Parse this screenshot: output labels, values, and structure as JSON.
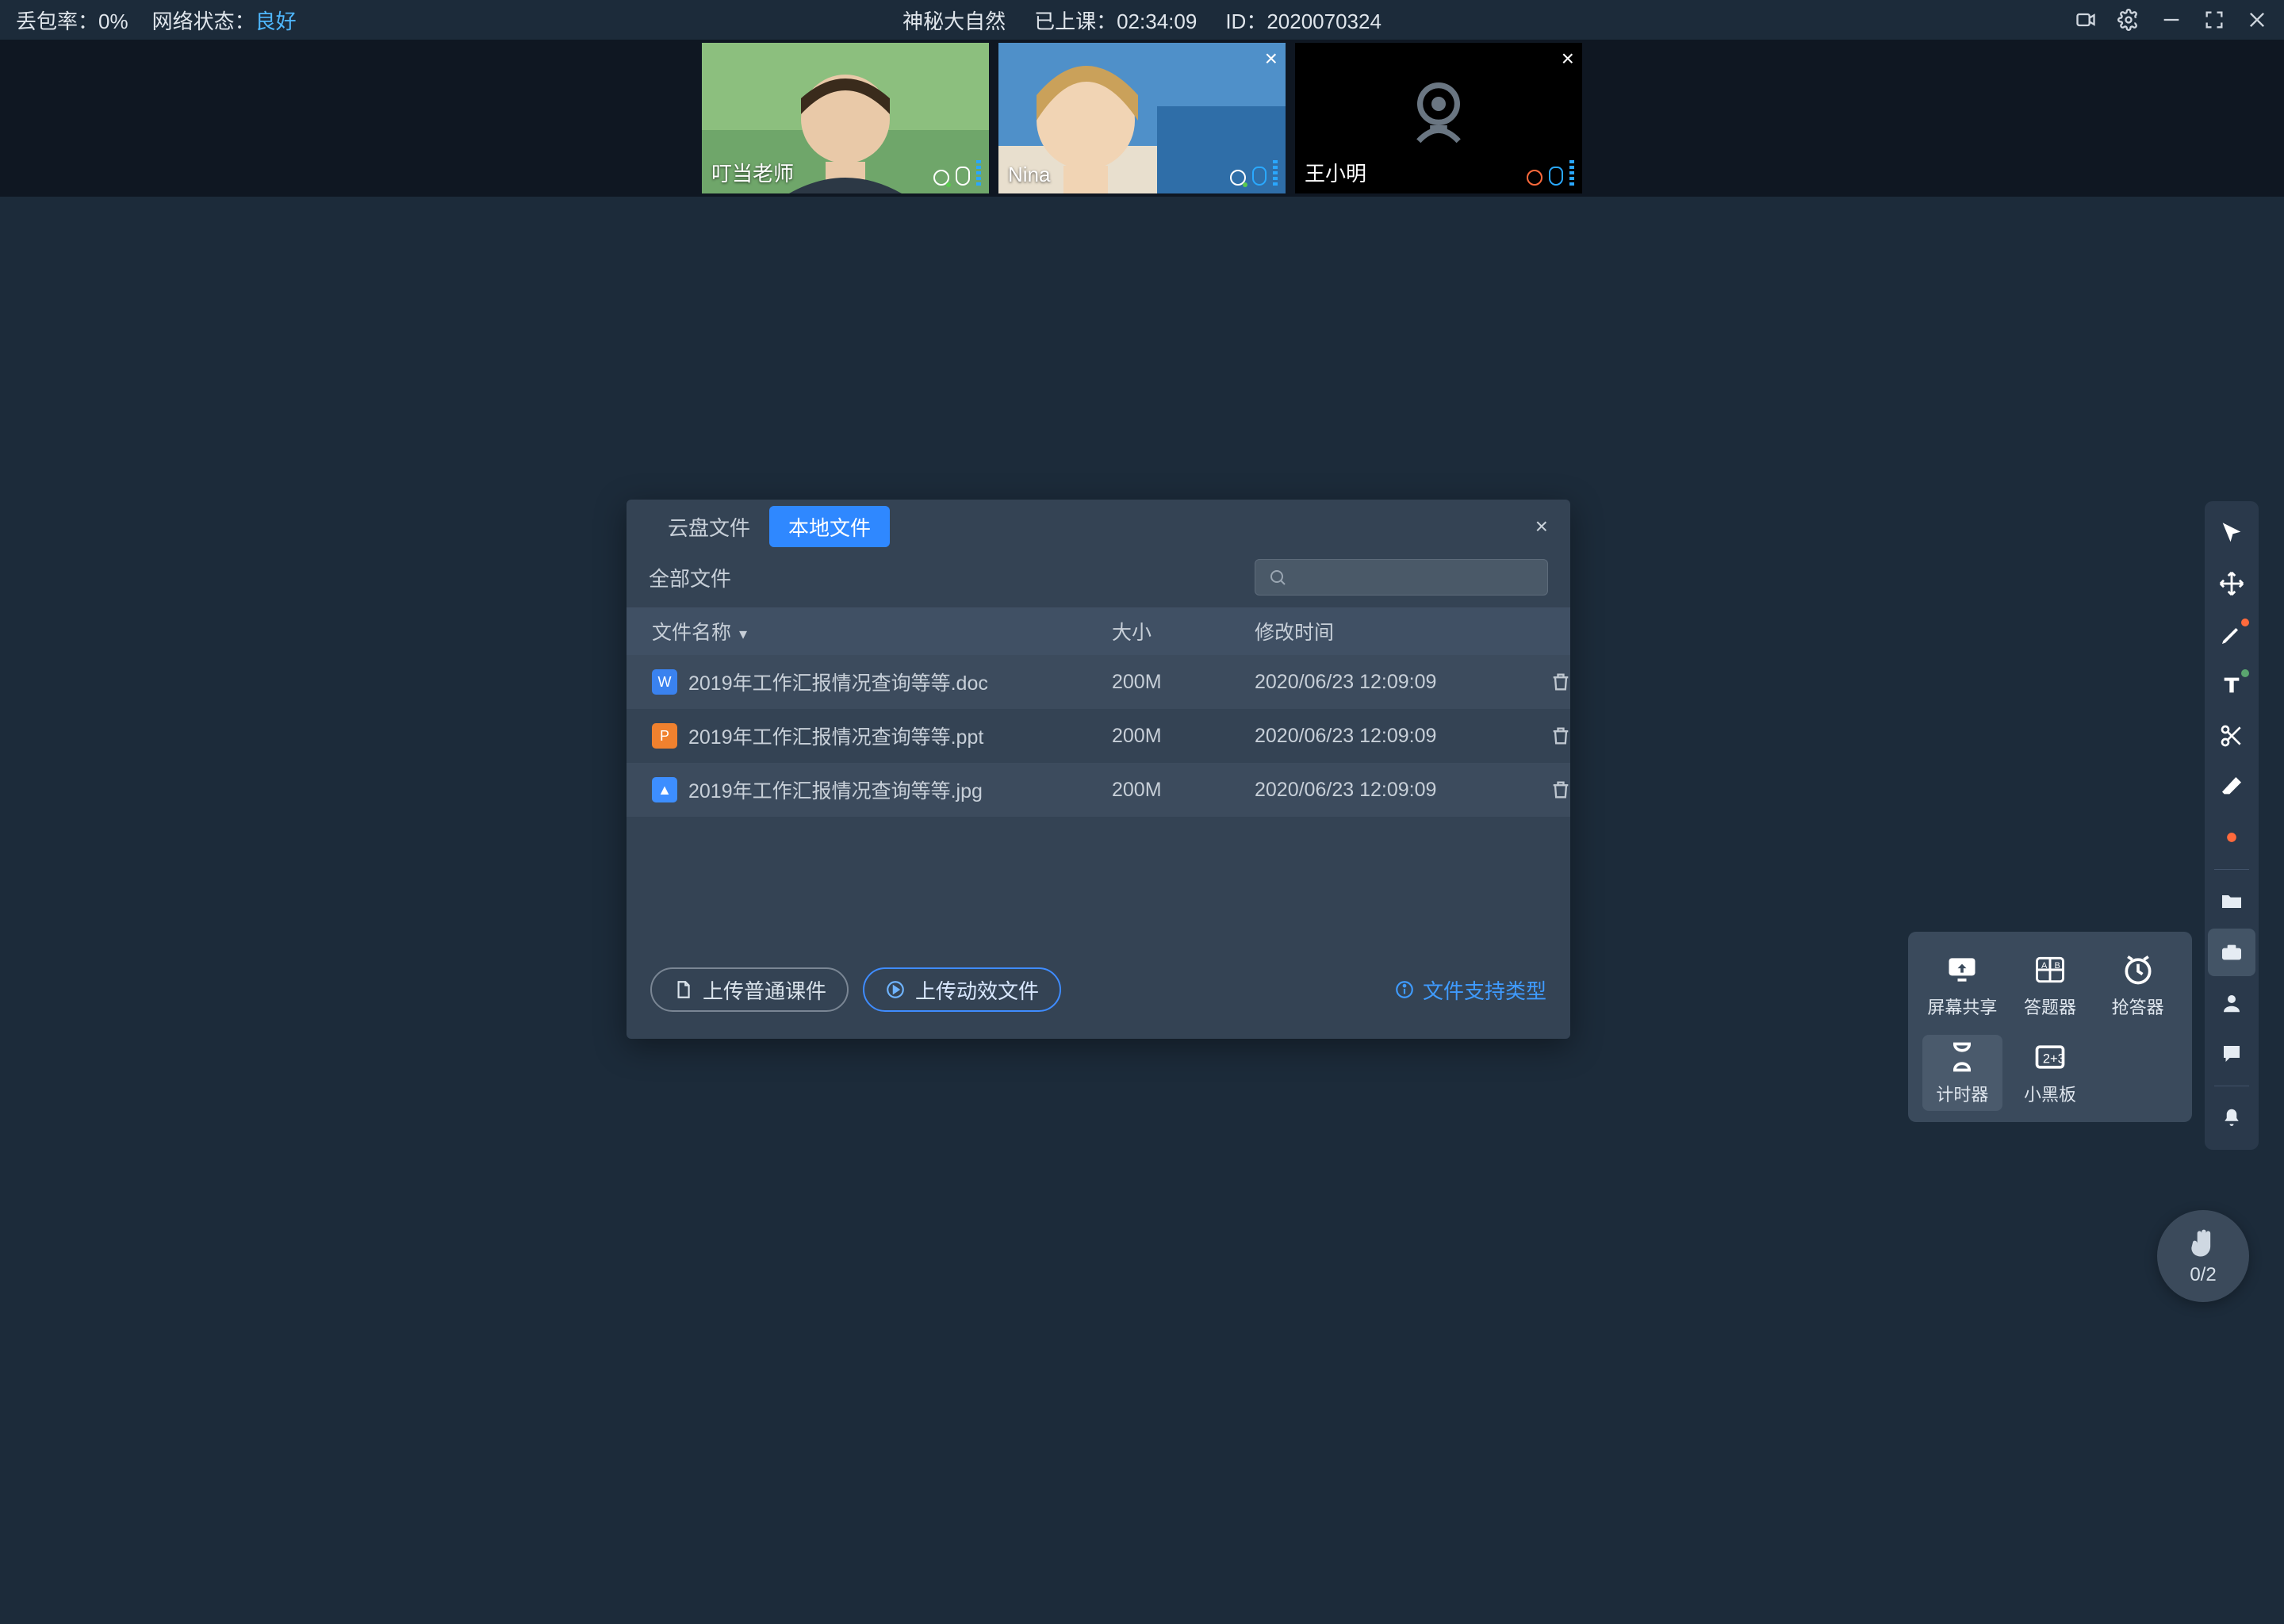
{
  "topbar": {
    "packet_loss_label": "丢包率：",
    "packet_loss_value": "0%",
    "net_status_label": "网络状态：",
    "net_status_value": "良好",
    "title": "神秘大自然",
    "duration_label": "已上课：",
    "duration_value": "02:34:09",
    "id_label": "ID：",
    "id_value": "2020070324"
  },
  "videos": [
    {
      "name": "叮当老师",
      "camera": "on",
      "mic": "on",
      "closable": false
    },
    {
      "name": "Nina",
      "camera": "on",
      "mic": "on",
      "closable": true
    },
    {
      "name": "王小明",
      "camera": "off",
      "mic": "on",
      "closable": true,
      "cam_muted": true
    }
  ],
  "modal": {
    "tabs": {
      "cloud": "云盘文件",
      "local": "本地文件"
    },
    "filter_all": "全部文件",
    "columns": {
      "name": "文件名称",
      "size": "大小",
      "mtime": "修改时间"
    },
    "files": [
      {
        "icon": "w",
        "name": "2019年工作汇报情况查询等等.doc",
        "size": "200M",
        "mtime": "2020/06/23 12:09:09"
      },
      {
        "icon": "p",
        "name": "2019年工作汇报情况查询等等.ppt",
        "size": "200M",
        "mtime": "2020/06/23 12:09:09"
      },
      {
        "icon": "img",
        "name": "2019年工作汇报情况查询等等.jpg",
        "size": "200M",
        "mtime": "2020/06/23 12:09:09"
      }
    ],
    "upload_normal": "上传普通课件",
    "upload_dynamic": "上传动效文件",
    "support_link": "文件支持类型"
  },
  "tools_popup": {
    "screen_share": "屏幕共享",
    "answer_tool": "答题器",
    "buzz_tool": "抢答器",
    "timer": "计时器",
    "blackboard": "小黑板"
  },
  "raise_hand": {
    "ratio": "0/2"
  }
}
